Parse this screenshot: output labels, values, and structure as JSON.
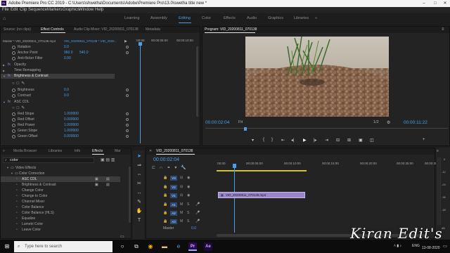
{
  "titlebar": {
    "text": "Adobe Premiere Pro CC 2019 - C:\\Users\\shwetha\\Documents\\Adobe\\Premiere Pro\\13.0\\swetha title new *",
    "icon": "Pr"
  },
  "menu": [
    "File",
    "Edit",
    "Clip",
    "Sequence",
    "Markers",
    "Graphics",
    "Window",
    "Help"
  ],
  "workspaces": [
    "Learning",
    "Assembly",
    "Editing",
    "Color",
    "Effects",
    "Audio",
    "Graphics",
    "Libraries"
  ],
  "active_workspace": "Editing",
  "source_panel": {
    "tabs": [
      "Source: (no clips)",
      "Effect Controls",
      "Audio Clip Mixer: VID_20200811_070138",
      "Metadata"
    ],
    "clip_path": "Master * VID_20200811_070138.mp4",
    "clip_seq": "VID_20200811_070138 * VID_2020...",
    "ruler": [
      ":00:00",
      "00:00:05:00",
      "00:00:10:00"
    ],
    "rows": [
      {
        "label": "Rotation",
        "value": "0.0"
      },
      {
        "label": "Anchor Point",
        "value": "960.0",
        "value2": "540.0"
      },
      {
        "label": "Anti-flicker Filter",
        "value": "0.00"
      },
      {
        "label": "Opacity",
        "value": ""
      },
      {
        "label": "Time Remapping",
        "value": ""
      },
      {
        "label": "Brightness & Contrast",
        "value": ""
      },
      {
        "label": "Brightness",
        "value": "0.0"
      },
      {
        "label": "Contrast",
        "value": "0.0"
      },
      {
        "label": "ASC CDL",
        "value": ""
      },
      {
        "label": "Red Slope",
        "value": "1.000000"
      },
      {
        "label": "Red Offset",
        "value": "0.000000"
      },
      {
        "label": "Red Power",
        "value": "1.000000"
      },
      {
        "label": "Green Slope",
        "value": "1.000000"
      },
      {
        "label": "Green Offset",
        "value": "0.000000"
      }
    ],
    "fx_badge": "fx"
  },
  "program": {
    "title": "Program: VID_20200811_070138",
    "timecode": "00:00:02:04",
    "fit": "Fit",
    "ratio": "1/2",
    "duration": "00:00:11:22"
  },
  "project_panel": {
    "tabs": [
      "Media Browser",
      "Libraries",
      "Info",
      "Effects",
      "Mar"
    ],
    "search": "color",
    "tree": [
      {
        "label": "Video Effects",
        "level": 0
      },
      {
        "label": "Color Correction",
        "level": 1
      },
      {
        "label": "ASC CDL",
        "level": 2
      },
      {
        "label": "Brightness & Contrast",
        "level": 2
      },
      {
        "label": "Change Color",
        "level": 2
      },
      {
        "label": "Change to Color",
        "level": 2
      },
      {
        "label": "Channel Mixer",
        "level": 2
      },
      {
        "label": "Color Balance",
        "level": 2
      },
      {
        "label": "Color Balance (HLS)",
        "level": 2
      },
      {
        "label": "Equalize",
        "level": 2
      },
      {
        "label": "Lumetri Color",
        "level": 2
      },
      {
        "label": "Leave Color",
        "level": 2
      }
    ]
  },
  "timeline": {
    "tab": "VID_20200811_070138",
    "timecode": "00:00:02:04",
    "ruler": [
      ":00:00",
      "00:00:05:00",
      "00:00:10:00",
      "00:00:15:00",
      "00:00:20:00",
      "00:00:25:00",
      "00:00:30:00"
    ],
    "video_tracks": [
      "V3",
      "V2",
      "V1"
    ],
    "audio_tracks": [
      "A1",
      "A2",
      "A3"
    ],
    "master_label": "Master",
    "master_value": "0.0",
    "clip_label": "VID_20200811_070138.mp4",
    "clip_color": "#9a86c8"
  },
  "meter_labels": [
    "0",
    "-12",
    "-24",
    "-36",
    "-48",
    "dB"
  ],
  "taskbar": {
    "search_placeholder": "Type here to search",
    "time": "",
    "date": "13-08-2020",
    "lang": "ENG"
  },
  "watermark": "Kiran Edit's"
}
